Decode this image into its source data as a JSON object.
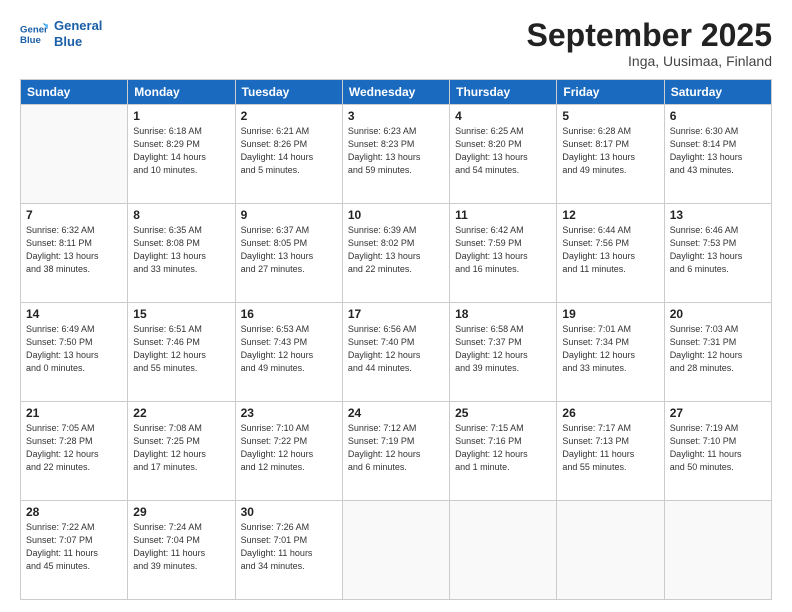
{
  "logo": {
    "line1": "General",
    "line2": "Blue"
  },
  "title": "September 2025",
  "subtitle": "Inga, Uusimaa, Finland",
  "weekdays": [
    "Sunday",
    "Monday",
    "Tuesday",
    "Wednesday",
    "Thursday",
    "Friday",
    "Saturday"
  ],
  "weeks": [
    [
      {
        "day": "",
        "detail": ""
      },
      {
        "day": "1",
        "detail": "Sunrise: 6:18 AM\nSunset: 8:29 PM\nDaylight: 14 hours\nand 10 minutes."
      },
      {
        "day": "2",
        "detail": "Sunrise: 6:21 AM\nSunset: 8:26 PM\nDaylight: 14 hours\nand 5 minutes."
      },
      {
        "day": "3",
        "detail": "Sunrise: 6:23 AM\nSunset: 8:23 PM\nDaylight: 13 hours\nand 59 minutes."
      },
      {
        "day": "4",
        "detail": "Sunrise: 6:25 AM\nSunset: 8:20 PM\nDaylight: 13 hours\nand 54 minutes."
      },
      {
        "day": "5",
        "detail": "Sunrise: 6:28 AM\nSunset: 8:17 PM\nDaylight: 13 hours\nand 49 minutes."
      },
      {
        "day": "6",
        "detail": "Sunrise: 6:30 AM\nSunset: 8:14 PM\nDaylight: 13 hours\nand 43 minutes."
      }
    ],
    [
      {
        "day": "7",
        "detail": "Sunrise: 6:32 AM\nSunset: 8:11 PM\nDaylight: 13 hours\nand 38 minutes."
      },
      {
        "day": "8",
        "detail": "Sunrise: 6:35 AM\nSunset: 8:08 PM\nDaylight: 13 hours\nand 33 minutes."
      },
      {
        "day": "9",
        "detail": "Sunrise: 6:37 AM\nSunset: 8:05 PM\nDaylight: 13 hours\nand 27 minutes."
      },
      {
        "day": "10",
        "detail": "Sunrise: 6:39 AM\nSunset: 8:02 PM\nDaylight: 13 hours\nand 22 minutes."
      },
      {
        "day": "11",
        "detail": "Sunrise: 6:42 AM\nSunset: 7:59 PM\nDaylight: 13 hours\nand 16 minutes."
      },
      {
        "day": "12",
        "detail": "Sunrise: 6:44 AM\nSunset: 7:56 PM\nDaylight: 13 hours\nand 11 minutes."
      },
      {
        "day": "13",
        "detail": "Sunrise: 6:46 AM\nSunset: 7:53 PM\nDaylight: 13 hours\nand 6 minutes."
      }
    ],
    [
      {
        "day": "14",
        "detail": "Sunrise: 6:49 AM\nSunset: 7:50 PM\nDaylight: 13 hours\nand 0 minutes."
      },
      {
        "day": "15",
        "detail": "Sunrise: 6:51 AM\nSunset: 7:46 PM\nDaylight: 12 hours\nand 55 minutes."
      },
      {
        "day": "16",
        "detail": "Sunrise: 6:53 AM\nSunset: 7:43 PM\nDaylight: 12 hours\nand 49 minutes."
      },
      {
        "day": "17",
        "detail": "Sunrise: 6:56 AM\nSunset: 7:40 PM\nDaylight: 12 hours\nand 44 minutes."
      },
      {
        "day": "18",
        "detail": "Sunrise: 6:58 AM\nSunset: 7:37 PM\nDaylight: 12 hours\nand 39 minutes."
      },
      {
        "day": "19",
        "detail": "Sunrise: 7:01 AM\nSunset: 7:34 PM\nDaylight: 12 hours\nand 33 minutes."
      },
      {
        "day": "20",
        "detail": "Sunrise: 7:03 AM\nSunset: 7:31 PM\nDaylight: 12 hours\nand 28 minutes."
      }
    ],
    [
      {
        "day": "21",
        "detail": "Sunrise: 7:05 AM\nSunset: 7:28 PM\nDaylight: 12 hours\nand 22 minutes."
      },
      {
        "day": "22",
        "detail": "Sunrise: 7:08 AM\nSunset: 7:25 PM\nDaylight: 12 hours\nand 17 minutes."
      },
      {
        "day": "23",
        "detail": "Sunrise: 7:10 AM\nSunset: 7:22 PM\nDaylight: 12 hours\nand 12 minutes."
      },
      {
        "day": "24",
        "detail": "Sunrise: 7:12 AM\nSunset: 7:19 PM\nDaylight: 12 hours\nand 6 minutes."
      },
      {
        "day": "25",
        "detail": "Sunrise: 7:15 AM\nSunset: 7:16 PM\nDaylight: 12 hours\nand 1 minute."
      },
      {
        "day": "26",
        "detail": "Sunrise: 7:17 AM\nSunset: 7:13 PM\nDaylight: 11 hours\nand 55 minutes."
      },
      {
        "day": "27",
        "detail": "Sunrise: 7:19 AM\nSunset: 7:10 PM\nDaylight: 11 hours\nand 50 minutes."
      }
    ],
    [
      {
        "day": "28",
        "detail": "Sunrise: 7:22 AM\nSunset: 7:07 PM\nDaylight: 11 hours\nand 45 minutes."
      },
      {
        "day": "29",
        "detail": "Sunrise: 7:24 AM\nSunset: 7:04 PM\nDaylight: 11 hours\nand 39 minutes."
      },
      {
        "day": "30",
        "detail": "Sunrise: 7:26 AM\nSunset: 7:01 PM\nDaylight: 11 hours\nand 34 minutes."
      },
      {
        "day": "",
        "detail": ""
      },
      {
        "day": "",
        "detail": ""
      },
      {
        "day": "",
        "detail": ""
      },
      {
        "day": "",
        "detail": ""
      }
    ]
  ]
}
